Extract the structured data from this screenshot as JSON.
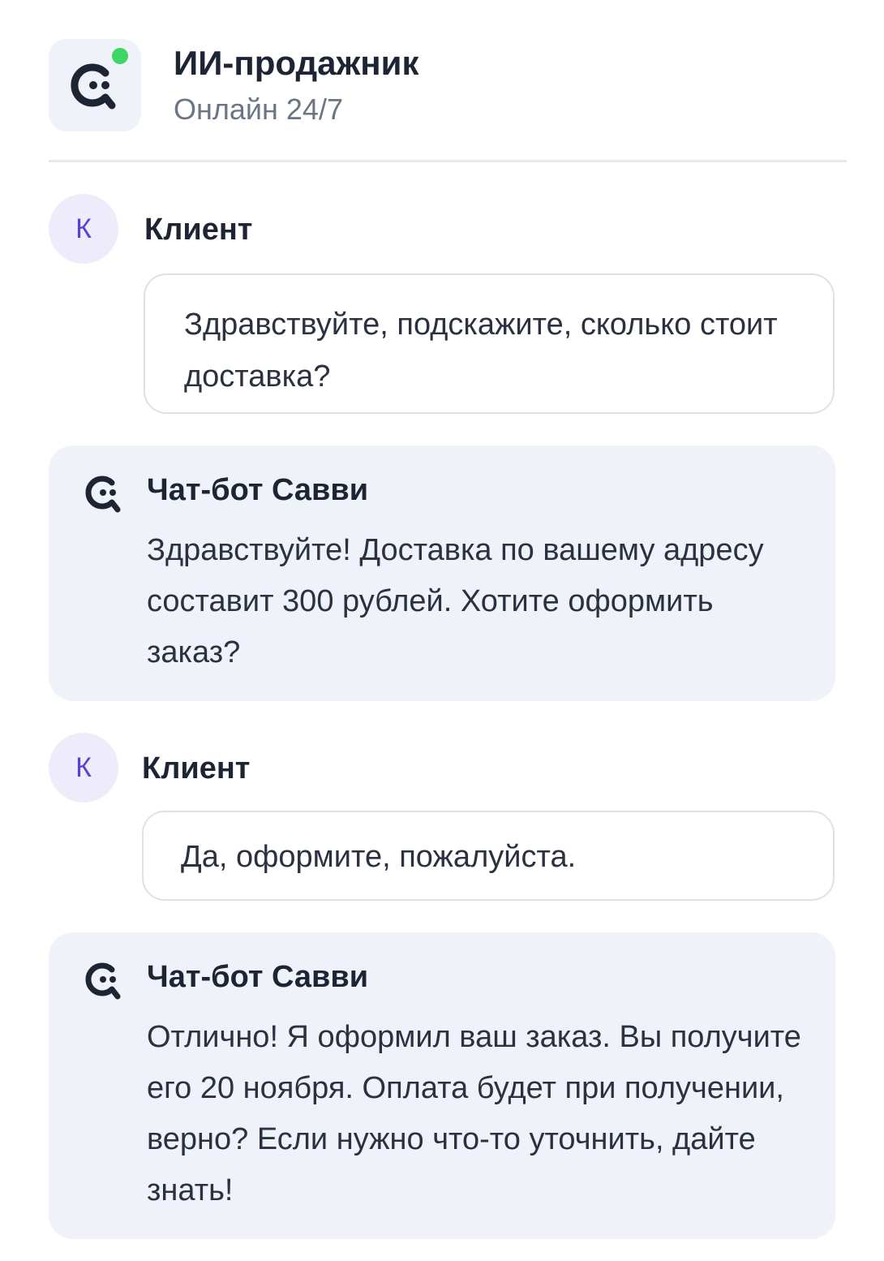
{
  "header": {
    "title": "ИИ-продажник",
    "subtitle": "Онлайн 24/7",
    "logo_icon": "savvi-chat-icon",
    "status_color": "#3ed665"
  },
  "messages": [
    {
      "sender": "client",
      "avatar_letter": "К",
      "name": "Клиент",
      "text": "Здравствуйте, подскажите, сколько стоит доставка?"
    },
    {
      "sender": "bot",
      "avatar_icon": "savvi-chat-icon",
      "name": "Чат-бот Савви",
      "text": "Здравствуйте! Доставка по вашему адресу составит 300 рублей. Хотите оформить заказ?"
    },
    {
      "sender": "client",
      "avatar_letter": "К",
      "name": "Клиент",
      "text": "Да, оформите, пожалуйста."
    },
    {
      "sender": "bot",
      "avatar_icon": "savvi-chat-icon",
      "name": "Чат-бот Савви",
      "text": "Отлично! Я оформил ваш заказ. Вы получите его 20 ноября. Оплата будет при получении, верно? Если нужно что-то уточнить, дайте знать!"
    }
  ],
  "colors": {
    "accent_purple": "#5b3fd1",
    "bot_bubble_bg": "#eff2f9",
    "text_dark": "#1d2433"
  }
}
